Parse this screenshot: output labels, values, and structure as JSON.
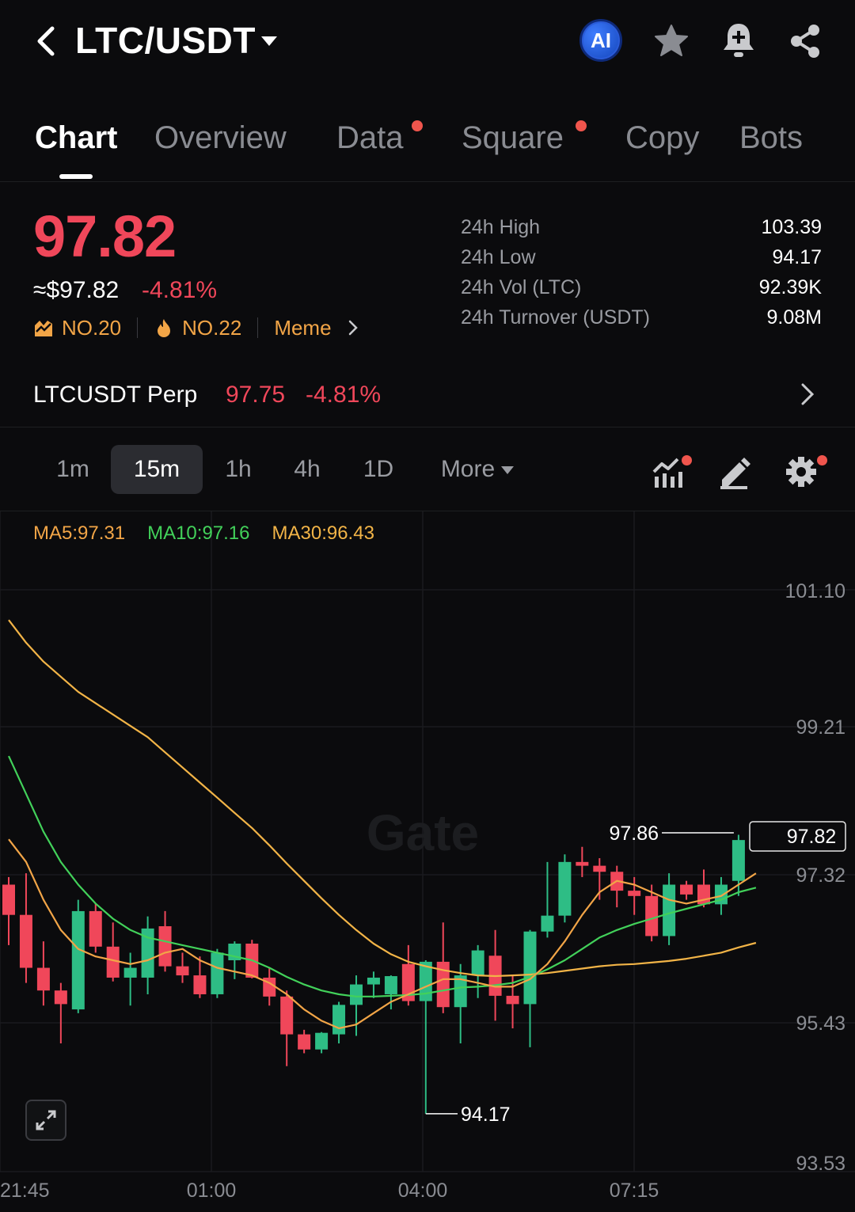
{
  "header": {
    "pair": "LTC/USDT",
    "ai_label": "AI",
    "icons": [
      "back-icon",
      "caret-down-icon",
      "ai-icon",
      "star-icon",
      "bell-plus-icon",
      "share-icon"
    ]
  },
  "tabs": [
    {
      "label": "Chart",
      "active": true,
      "dot": false
    },
    {
      "label": "Overview",
      "active": false,
      "dot": false
    },
    {
      "label": "Data",
      "active": false,
      "dot": true
    },
    {
      "label": "Square",
      "active": false,
      "dot": true
    },
    {
      "label": "Copy",
      "active": false,
      "dot": false
    },
    {
      "label": "Bots",
      "active": false,
      "dot": false
    }
  ],
  "price": {
    "last": "97.82",
    "fiat": "≈$97.82",
    "change": "-4.81%",
    "ranks": [
      {
        "icon": "trending-chart-icon",
        "label": "NO.20"
      },
      {
        "icon": "flame-icon",
        "label": "NO.22"
      },
      {
        "icon": "chevron-right-icon",
        "label": "Meme"
      }
    ]
  },
  "stats": [
    {
      "label": "24h High",
      "value": "103.39"
    },
    {
      "label": "24h Low",
      "value": "94.17"
    },
    {
      "label": "24h Vol (LTC)",
      "value": "92.39K"
    },
    {
      "label": "24h Turnover (USDT)",
      "value": "9.08M"
    }
  ],
  "perp": {
    "name": "LTCUSDT Perp",
    "price": "97.75",
    "change": "-4.81%"
  },
  "intervals": [
    {
      "label": "1m",
      "active": false
    },
    {
      "label": "15m",
      "active": true
    },
    {
      "label": "1h",
      "active": false
    },
    {
      "label": "4h",
      "active": false
    },
    {
      "label": "1D",
      "active": false
    },
    {
      "label": "More",
      "active": false
    }
  ],
  "tools": [
    "indicator-icon",
    "draw-pencil-icon",
    "settings-gear-icon"
  ],
  "ma_legend": {
    "ma5": "MA5:97.31",
    "ma10": "MA10:97.16",
    "ma30": "MA30:96.43"
  },
  "colors": {
    "up": "#2ebd85",
    "down": "#f0475a",
    "ma5": "#f2a547",
    "ma10": "#42d15a",
    "ma30": "#f2b447",
    "accent": "#f0554d"
  },
  "chart_data": {
    "type": "candlestick",
    "interval": "15m",
    "y_ticks": [
      "101.10",
      "99.21",
      "97.32",
      "95.43",
      "93.53"
    ],
    "ylim": [
      93.53,
      101.6
    ],
    "x_ticks": [
      "21:45",
      "01:00",
      "04:00",
      "07:15"
    ],
    "current_price_label": "97.82",
    "high_marker": "97.86",
    "low_marker": "94.17",
    "watermark": "Gate",
    "candles": [
      {
        "o": 97.2,
        "h": 97.3,
        "l": 96.4,
        "c": 96.8
      },
      {
        "o": 96.8,
        "h": 97.35,
        "l": 95.9,
        "c": 96.1
      },
      {
        "o": 96.1,
        "h": 96.45,
        "l": 95.6,
        "c": 95.8
      },
      {
        "o": 95.8,
        "h": 95.9,
        "l": 95.1,
        "c": 95.62
      },
      {
        "o": 95.55,
        "h": 97.0,
        "l": 95.5,
        "c": 96.85
      },
      {
        "o": 96.85,
        "h": 96.95,
        "l": 96.3,
        "c": 96.38
      },
      {
        "o": 96.38,
        "h": 96.7,
        "l": 95.92,
        "c": 95.97
      },
      {
        "o": 95.97,
        "h": 96.3,
        "l": 95.6,
        "c": 96.1
      },
      {
        "o": 95.97,
        "h": 96.78,
        "l": 95.75,
        "c": 96.62
      },
      {
        "o": 96.65,
        "h": 96.85,
        "l": 96.05,
        "c": 96.12
      },
      {
        "o": 96.12,
        "h": 96.3,
        "l": 95.9,
        "c": 96.0
      },
      {
        "o": 96.0,
        "h": 96.25,
        "l": 95.7,
        "c": 95.75
      },
      {
        "o": 95.75,
        "h": 96.35,
        "l": 95.7,
        "c": 96.3
      },
      {
        "o": 96.2,
        "h": 96.45,
        "l": 95.95,
        "c": 96.42
      },
      {
        "o": 96.42,
        "h": 96.47,
        "l": 95.96,
        "c": 95.97
      },
      {
        "o": 95.97,
        "h": 96.1,
        "l": 95.6,
        "c": 95.72
      },
      {
        "o": 95.72,
        "h": 95.8,
        "l": 94.8,
        "c": 95.22
      },
      {
        "o": 95.22,
        "h": 95.28,
        "l": 94.97,
        "c": 95.02
      },
      {
        "o": 95.02,
        "h": 95.25,
        "l": 94.97,
        "c": 95.24
      },
      {
        "o": 95.22,
        "h": 95.65,
        "l": 95.1,
        "c": 95.61
      },
      {
        "o": 95.61,
        "h": 96.0,
        "l": 95.2,
        "c": 95.88
      },
      {
        "o": 95.88,
        "h": 96.05,
        "l": 95.7,
        "c": 95.97
      },
      {
        "o": 95.75,
        "h": 96.0,
        "l": 95.55,
        "c": 95.99
      },
      {
        "o": 96.15,
        "h": 96.4,
        "l": 95.6,
        "c": 95.66
      },
      {
        "o": 95.66,
        "h": 96.2,
        "l": 94.17,
        "c": 96.18
      },
      {
        "o": 96.18,
        "h": 96.7,
        "l": 95.5,
        "c": 95.58
      },
      {
        "o": 95.58,
        "h": 96.15,
        "l": 95.1,
        "c": 96.0
      },
      {
        "o": 96.0,
        "h": 96.4,
        "l": 95.7,
        "c": 96.33
      },
      {
        "o": 96.26,
        "h": 96.6,
        "l": 95.4,
        "c": 95.73
      },
      {
        "o": 95.73,
        "h": 96.0,
        "l": 95.3,
        "c": 95.62
      },
      {
        "o": 95.62,
        "h": 96.6,
        "l": 95.05,
        "c": 96.58
      },
      {
        "o": 96.58,
        "h": 97.5,
        "l": 96.5,
        "c": 96.79
      },
      {
        "o": 96.79,
        "h": 97.6,
        "l": 96.7,
        "c": 97.5
      },
      {
        "o": 97.5,
        "h": 97.7,
        "l": 97.3,
        "c": 97.45
      },
      {
        "o": 97.45,
        "h": 97.55,
        "l": 97.0,
        "c": 97.37
      },
      {
        "o": 97.37,
        "h": 97.45,
        "l": 96.9,
        "c": 97.12
      },
      {
        "o": 97.12,
        "h": 97.3,
        "l": 96.8,
        "c": 97.05
      },
      {
        "o": 97.05,
        "h": 97.2,
        "l": 96.45,
        "c": 96.52
      },
      {
        "o": 96.52,
        "h": 97.35,
        "l": 96.4,
        "c": 97.2
      },
      {
        "o": 97.2,
        "h": 97.25,
        "l": 97.0,
        "c": 97.07
      },
      {
        "o": 97.2,
        "h": 97.4,
        "l": 96.9,
        "c": 96.94
      },
      {
        "o": 96.94,
        "h": 97.3,
        "l": 96.8,
        "c": 97.2
      },
      {
        "o": 97.25,
        "h": 97.86,
        "l": 97.05,
        "c": 97.79
      },
      {
        "o": 97.75,
        "h": 97.86,
        "l": 97.7,
        "c": 97.82
      }
    ],
    "ma5": [
      97.8,
      97.5,
      97.0,
      96.6,
      96.35,
      96.25,
      96.2,
      96.15,
      96.2,
      96.3,
      96.35,
      96.2,
      96.1,
      96.05,
      96.0,
      95.9,
      95.75,
      95.55,
      95.4,
      95.3,
      95.35,
      95.5,
      95.65,
      95.75,
      95.85,
      95.95,
      95.95,
      95.9,
      95.85,
      95.85,
      95.95,
      96.15,
      96.45,
      96.8,
      97.1,
      97.25,
      97.2,
      97.1,
      97.0,
      96.95,
      97.0,
      97.05,
      97.2,
      97.35
    ],
    "ma10": [
      98.9,
      98.4,
      97.9,
      97.5,
      97.2,
      96.95,
      96.75,
      96.6,
      96.5,
      96.45,
      96.4,
      96.35,
      96.3,
      96.25,
      96.2,
      96.1,
      95.98,
      95.88,
      95.8,
      95.75,
      95.72,
      95.72,
      95.73,
      95.74,
      95.76,
      95.8,
      95.84,
      95.85,
      95.87,
      95.9,
      95.98,
      96.08,
      96.2,
      96.35,
      96.5,
      96.6,
      96.68,
      96.75,
      96.82,
      96.88,
      96.94,
      97.0,
      97.1,
      97.16
    ],
    "ma30": [
      100.7,
      100.4,
      100.15,
      99.95,
      99.75,
      99.6,
      99.45,
      99.3,
      99.15,
      98.95,
      98.75,
      98.55,
      98.35,
      98.15,
      97.95,
      97.72,
      97.48,
      97.25,
      97.02,
      96.8,
      96.6,
      96.42,
      96.28,
      96.18,
      96.12,
      96.07,
      96.03,
      96.0,
      95.99,
      96.0,
      96.01,
      96.03,
      96.06,
      96.09,
      96.12,
      96.14,
      96.15,
      96.17,
      96.19,
      96.22,
      96.26,
      96.3,
      96.37,
      96.43
    ]
  }
}
